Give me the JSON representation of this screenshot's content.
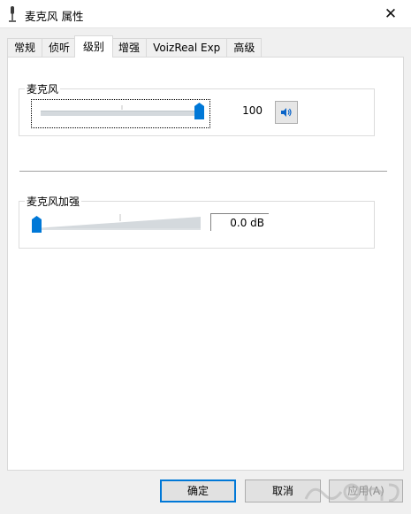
{
  "window": {
    "title": "麦克风 属性",
    "close_glyph": "✕"
  },
  "tabs": [
    {
      "label": "常规",
      "active": false
    },
    {
      "label": "侦听",
      "active": false
    },
    {
      "label": "级别",
      "active": true
    },
    {
      "label": "增强",
      "active": false
    },
    {
      "label": "VoizReal Exp",
      "active": false
    },
    {
      "label": "高级",
      "active": false
    }
  ],
  "microphone": {
    "label": "麦克风",
    "level": 100,
    "level_max": 100,
    "value_text": "100",
    "mute_icon": "speaker-icon"
  },
  "boost": {
    "label": "麦克风加强",
    "level_fraction": 0,
    "value_text": "0.0 dB"
  },
  "buttons": {
    "ok": "确定",
    "cancel": "取消",
    "apply": "应用(A)"
  },
  "colors": {
    "accent": "#0078d7",
    "slider_track": "#d4d9dd"
  }
}
